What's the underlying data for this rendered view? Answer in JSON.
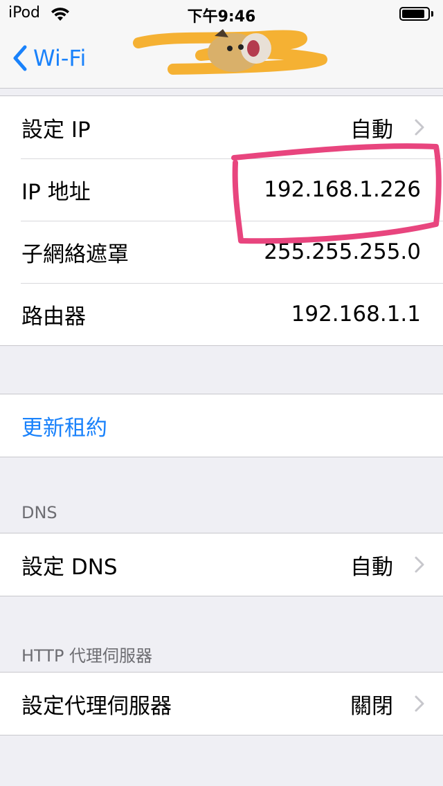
{
  "status_bar": {
    "carrier": "iPod",
    "time": "下午9:46",
    "battery_level": 0.9
  },
  "nav": {
    "back_label": "Wi-Fi"
  },
  "ip_group": [
    {
      "label": "設定 IP",
      "value": "自動",
      "chevron": true
    },
    {
      "label": "IP 地址",
      "value": "192.168.1.226",
      "chevron": false
    },
    {
      "label": "子網絡遮罩",
      "value": "255.255.255.0",
      "chevron": false
    },
    {
      "label": "路由器",
      "value": "192.168.1.1",
      "chevron": false
    }
  ],
  "renew_lease": {
    "label": "更新租約"
  },
  "dns": {
    "header": "DNS",
    "label": "設定 DNS",
    "value": "自動"
  },
  "proxy": {
    "header": "HTTP 代理伺服器",
    "label": "設定代理伺服器",
    "value": "關閉"
  },
  "colors": {
    "accent": "#1a82fb",
    "background": "#efeff4",
    "annotation": "#e8457e",
    "scribble": "#f5b133"
  }
}
